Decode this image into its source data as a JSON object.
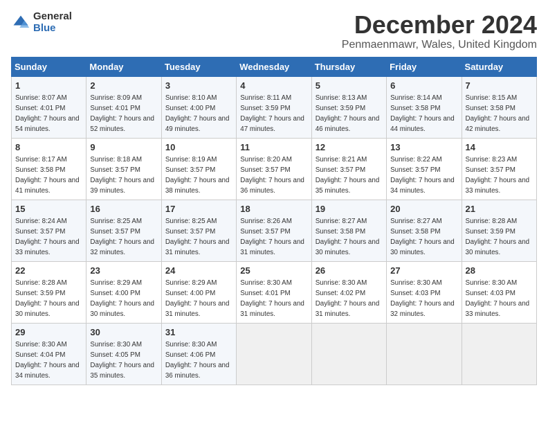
{
  "logo": {
    "general": "General",
    "blue": "Blue"
  },
  "header": {
    "title": "December 2024",
    "subtitle": "Penmaenmawr, Wales, United Kingdom"
  },
  "weekdays": [
    "Sunday",
    "Monday",
    "Tuesday",
    "Wednesday",
    "Thursday",
    "Friday",
    "Saturday"
  ],
  "weeks": [
    [
      {
        "day": "1",
        "sunrise": "Sunrise: 8:07 AM",
        "sunset": "Sunset: 4:01 PM",
        "daylight": "Daylight: 7 hours and 54 minutes."
      },
      {
        "day": "2",
        "sunrise": "Sunrise: 8:09 AM",
        "sunset": "Sunset: 4:01 PM",
        "daylight": "Daylight: 7 hours and 52 minutes."
      },
      {
        "day": "3",
        "sunrise": "Sunrise: 8:10 AM",
        "sunset": "Sunset: 4:00 PM",
        "daylight": "Daylight: 7 hours and 49 minutes."
      },
      {
        "day": "4",
        "sunrise": "Sunrise: 8:11 AM",
        "sunset": "Sunset: 3:59 PM",
        "daylight": "Daylight: 7 hours and 47 minutes."
      },
      {
        "day": "5",
        "sunrise": "Sunrise: 8:13 AM",
        "sunset": "Sunset: 3:59 PM",
        "daylight": "Daylight: 7 hours and 46 minutes."
      },
      {
        "day": "6",
        "sunrise": "Sunrise: 8:14 AM",
        "sunset": "Sunset: 3:58 PM",
        "daylight": "Daylight: 7 hours and 44 minutes."
      },
      {
        "day": "7",
        "sunrise": "Sunrise: 8:15 AM",
        "sunset": "Sunset: 3:58 PM",
        "daylight": "Daylight: 7 hours and 42 minutes."
      }
    ],
    [
      {
        "day": "8",
        "sunrise": "Sunrise: 8:17 AM",
        "sunset": "Sunset: 3:58 PM",
        "daylight": "Daylight: 7 hours and 41 minutes."
      },
      {
        "day": "9",
        "sunrise": "Sunrise: 8:18 AM",
        "sunset": "Sunset: 3:57 PM",
        "daylight": "Daylight: 7 hours and 39 minutes."
      },
      {
        "day": "10",
        "sunrise": "Sunrise: 8:19 AM",
        "sunset": "Sunset: 3:57 PM",
        "daylight": "Daylight: 7 hours and 38 minutes."
      },
      {
        "day": "11",
        "sunrise": "Sunrise: 8:20 AM",
        "sunset": "Sunset: 3:57 PM",
        "daylight": "Daylight: 7 hours and 36 minutes."
      },
      {
        "day": "12",
        "sunrise": "Sunrise: 8:21 AM",
        "sunset": "Sunset: 3:57 PM",
        "daylight": "Daylight: 7 hours and 35 minutes."
      },
      {
        "day": "13",
        "sunrise": "Sunrise: 8:22 AM",
        "sunset": "Sunset: 3:57 PM",
        "daylight": "Daylight: 7 hours and 34 minutes."
      },
      {
        "day": "14",
        "sunrise": "Sunrise: 8:23 AM",
        "sunset": "Sunset: 3:57 PM",
        "daylight": "Daylight: 7 hours and 33 minutes."
      }
    ],
    [
      {
        "day": "15",
        "sunrise": "Sunrise: 8:24 AM",
        "sunset": "Sunset: 3:57 PM",
        "daylight": "Daylight: 7 hours and 33 minutes."
      },
      {
        "day": "16",
        "sunrise": "Sunrise: 8:25 AM",
        "sunset": "Sunset: 3:57 PM",
        "daylight": "Daylight: 7 hours and 32 minutes."
      },
      {
        "day": "17",
        "sunrise": "Sunrise: 8:25 AM",
        "sunset": "Sunset: 3:57 PM",
        "daylight": "Daylight: 7 hours and 31 minutes."
      },
      {
        "day": "18",
        "sunrise": "Sunrise: 8:26 AM",
        "sunset": "Sunset: 3:57 PM",
        "daylight": "Daylight: 7 hours and 31 minutes."
      },
      {
        "day": "19",
        "sunrise": "Sunrise: 8:27 AM",
        "sunset": "Sunset: 3:58 PM",
        "daylight": "Daylight: 7 hours and 30 minutes."
      },
      {
        "day": "20",
        "sunrise": "Sunrise: 8:27 AM",
        "sunset": "Sunset: 3:58 PM",
        "daylight": "Daylight: 7 hours and 30 minutes."
      },
      {
        "day": "21",
        "sunrise": "Sunrise: 8:28 AM",
        "sunset": "Sunset: 3:59 PM",
        "daylight": "Daylight: 7 hours and 30 minutes."
      }
    ],
    [
      {
        "day": "22",
        "sunrise": "Sunrise: 8:28 AM",
        "sunset": "Sunset: 3:59 PM",
        "daylight": "Daylight: 7 hours and 30 minutes."
      },
      {
        "day": "23",
        "sunrise": "Sunrise: 8:29 AM",
        "sunset": "Sunset: 4:00 PM",
        "daylight": "Daylight: 7 hours and 30 minutes."
      },
      {
        "day": "24",
        "sunrise": "Sunrise: 8:29 AM",
        "sunset": "Sunset: 4:00 PM",
        "daylight": "Daylight: 7 hours and 31 minutes."
      },
      {
        "day": "25",
        "sunrise": "Sunrise: 8:30 AM",
        "sunset": "Sunset: 4:01 PM",
        "daylight": "Daylight: 7 hours and 31 minutes."
      },
      {
        "day": "26",
        "sunrise": "Sunrise: 8:30 AM",
        "sunset": "Sunset: 4:02 PM",
        "daylight": "Daylight: 7 hours and 31 minutes."
      },
      {
        "day": "27",
        "sunrise": "Sunrise: 8:30 AM",
        "sunset": "Sunset: 4:03 PM",
        "daylight": "Daylight: 7 hours and 32 minutes."
      },
      {
        "day": "28",
        "sunrise": "Sunrise: 8:30 AM",
        "sunset": "Sunset: 4:03 PM",
        "daylight": "Daylight: 7 hours and 33 minutes."
      }
    ],
    [
      {
        "day": "29",
        "sunrise": "Sunrise: 8:30 AM",
        "sunset": "Sunset: 4:04 PM",
        "daylight": "Daylight: 7 hours and 34 minutes."
      },
      {
        "day": "30",
        "sunrise": "Sunrise: 8:30 AM",
        "sunset": "Sunset: 4:05 PM",
        "daylight": "Daylight: 7 hours and 35 minutes."
      },
      {
        "day": "31",
        "sunrise": "Sunrise: 8:30 AM",
        "sunset": "Sunset: 4:06 PM",
        "daylight": "Daylight: 7 hours and 36 minutes."
      },
      null,
      null,
      null,
      null
    ]
  ]
}
